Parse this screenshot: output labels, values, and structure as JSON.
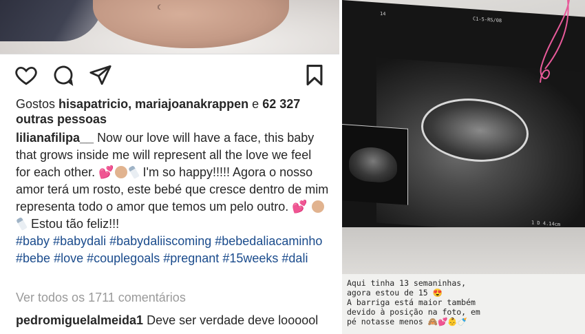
{
  "post": {
    "likes": {
      "prefix": "Gostos",
      "users": "hisapatricio, mariajoanakrappen",
      "connector": "e",
      "count": "62 327",
      "suffix": "outras pessoas"
    },
    "caption": {
      "username": "lilianafilipa__",
      "text_en": "Now our love will have a face, this baby that grows inside me will represent all the love we feel for each other.",
      "text_en_tail": "I'm so happy!!!!!",
      "text_pt": "Agora o nosso amor terá um rosto, este bebé que cresce dentro de mim representa todo o amor que temos um pelo outro.",
      "text_pt_tail": "Estou tão feliz!!!",
      "hashtags": [
        "#baby",
        "#babydali",
        "#babydaliiscoming",
        "#bebedaliacaminho",
        "#bebe",
        "#love",
        "#couplegoals",
        "#pregnant",
        "#15weeks",
        "#dali"
      ]
    },
    "view_all_comments": "Ver todos os 1711 comentários",
    "comment": {
      "username": "pedromiguelalmeida1",
      "text": "Deve ser verdade deve loooool"
    },
    "icons": [
      "heart-icon",
      "comment-icon",
      "share-icon",
      "bookmark-icon"
    ]
  },
  "story": {
    "lines": [
      "Aqui tinha 13 semaninhas,",
      "agora estou de 15 😍",
      "A barriga está maior também",
      "devido à posição na foto, em",
      "pé notasse menos 🙈💕👶🍼"
    ],
    "ultrasound_labels": {
      "top_left": "14",
      "top_center": "C1-5-RS/08",
      "measure": "1 D 4.14cm"
    }
  },
  "colors": {
    "text": "#262626",
    "hashtag": "#1a4b8c",
    "muted": "#9a9a9a",
    "heart_emoji": "#d0264f",
    "string_pink": "#e85a9a"
  }
}
